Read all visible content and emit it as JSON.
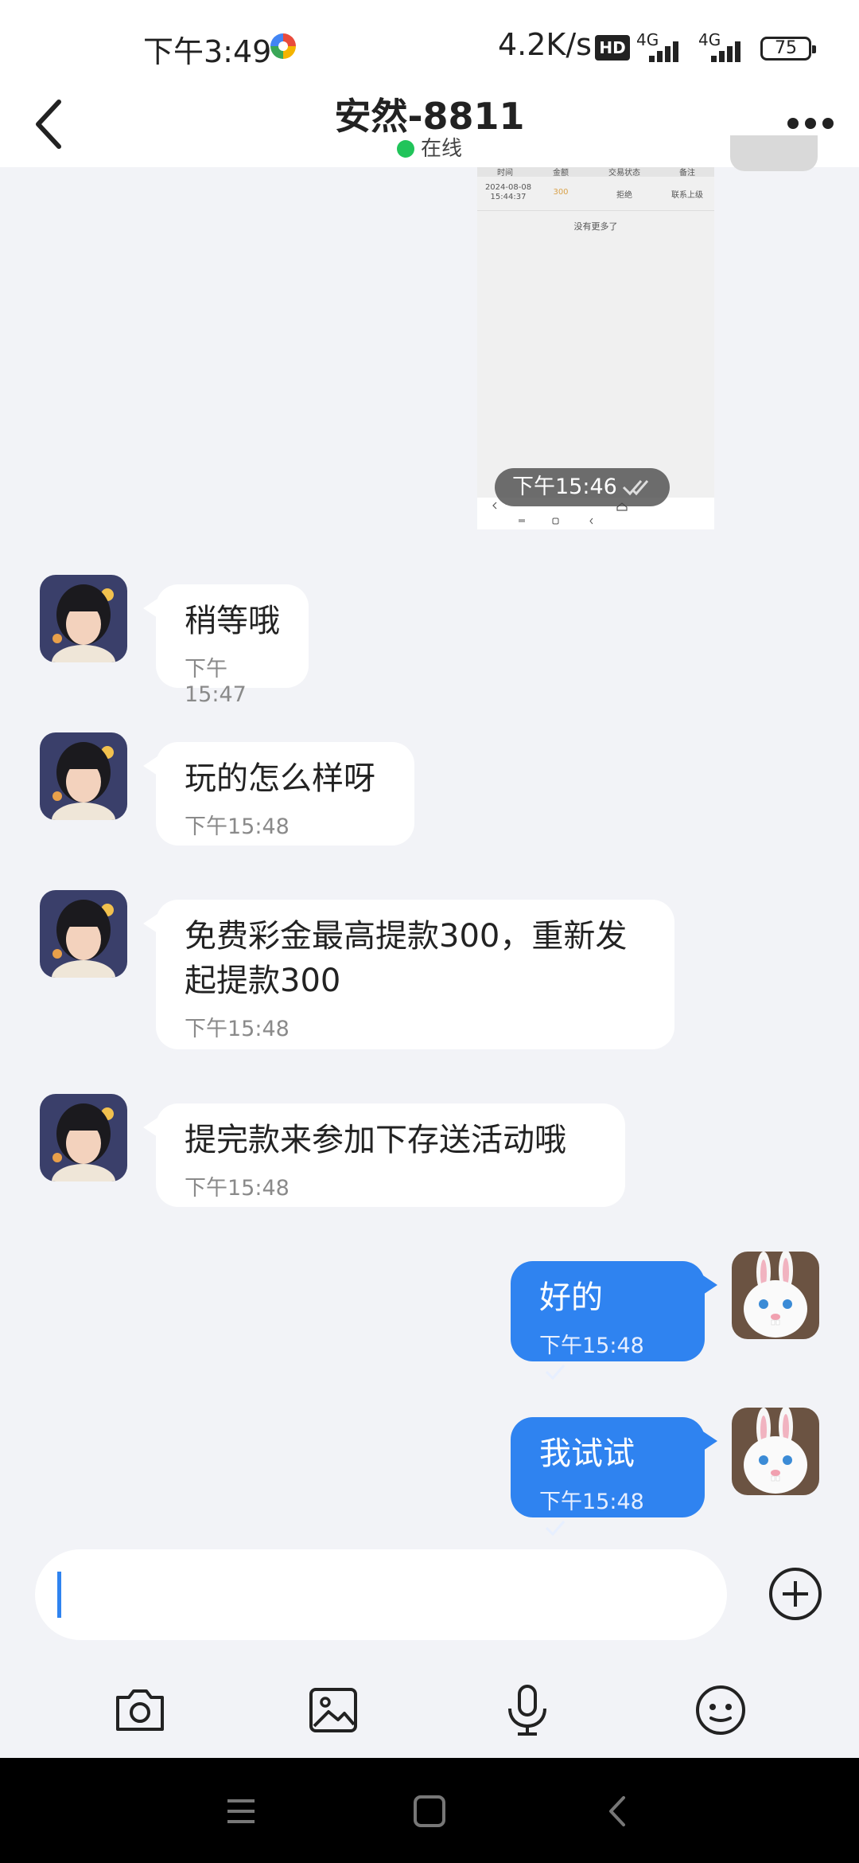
{
  "status_bar": {
    "time": "下午3:49",
    "speed": "4.2K/s",
    "hd_label": "HD",
    "net1": "4G",
    "net2": "4G",
    "battery": "75"
  },
  "header": {
    "title": "安然-8811",
    "status": "在线"
  },
  "shared_screenshot": {
    "table_headers": [
      "时间",
      "金额",
      "交易状态",
      "备注"
    ],
    "row_date": "2024-08-08",
    "row_time": "15:44:37",
    "row_amount": "300",
    "row_status": "拒绝",
    "row_note": "联系上级",
    "no_more": "没有更多了",
    "timestamp": "下午15:46"
  },
  "messages": [
    {
      "side": "in",
      "text": "稍等哦",
      "time": "下午15:47"
    },
    {
      "side": "in",
      "text": "玩的怎么样呀",
      "time": "下午15:48"
    },
    {
      "side": "in",
      "text": "免费彩金最高提款300，重新发起提款300",
      "time": "下午15:48"
    },
    {
      "side": "in",
      "text": "提完款来参加下存送活动哦",
      "time": "下午15:48"
    },
    {
      "side": "out",
      "text": "好的",
      "time": "下午15:48"
    },
    {
      "side": "out",
      "text": "我试试",
      "time": "下午15:48"
    }
  ],
  "input": {
    "value": ""
  },
  "colors": {
    "accent": "#2f83f0",
    "online": "#21c45a",
    "background": "#f2f3f7"
  },
  "icons": [
    "back-icon",
    "more-icon",
    "plus-icon",
    "camera-icon",
    "image-icon",
    "microphone-icon",
    "emoji-icon",
    "menu-icon",
    "home-icon",
    "back-nav-icon"
  ]
}
